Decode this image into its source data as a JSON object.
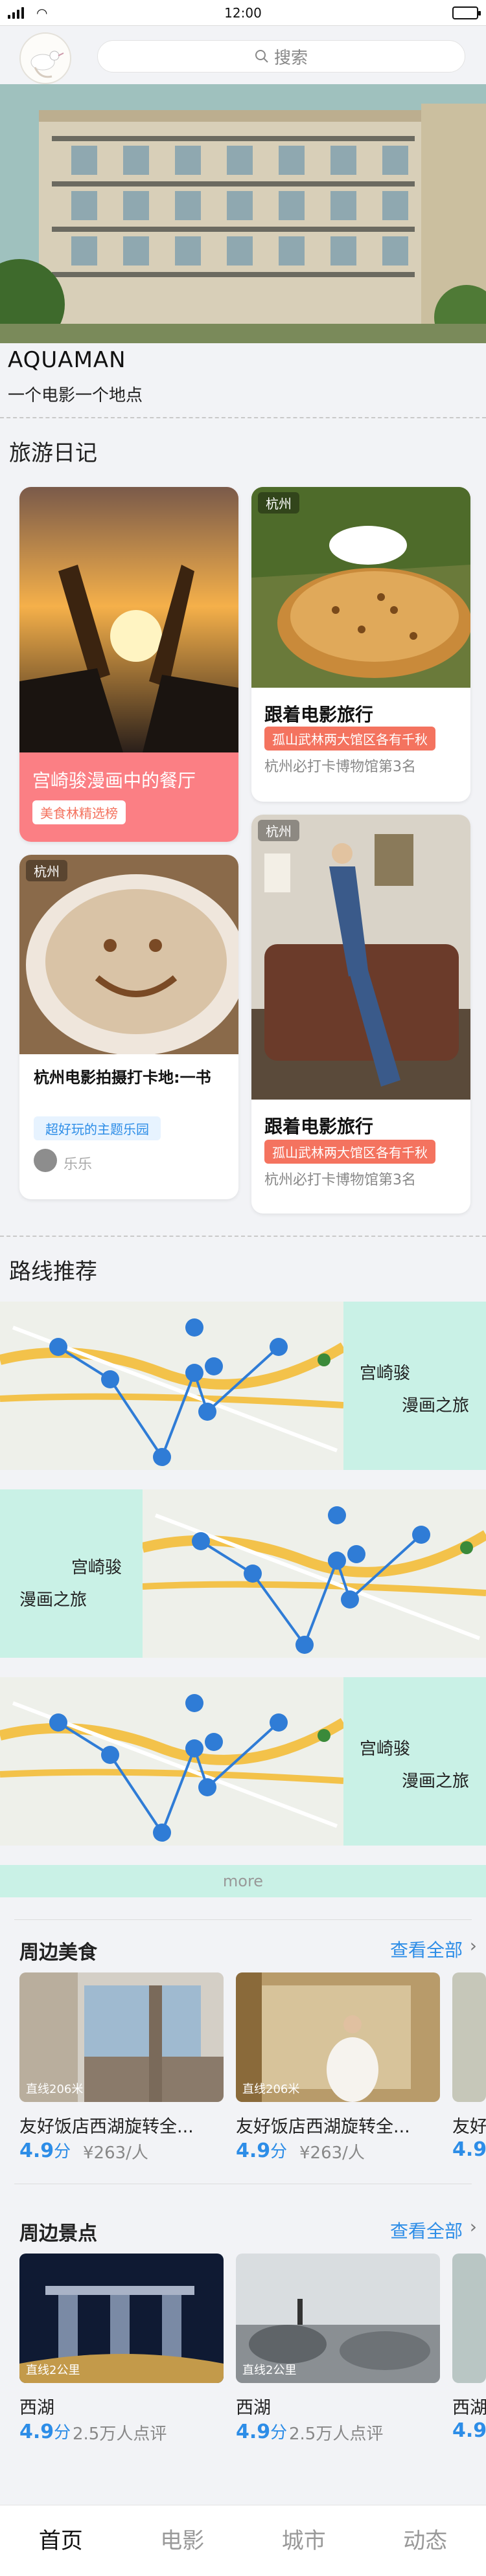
{
  "status": {
    "time": "12:00"
  },
  "header": {
    "search_placeholder": "搜索"
  },
  "brand": {
    "name": "AQUAMAN",
    "tagline": "一个电影一个地点"
  },
  "diary": {
    "title": "旅游日记",
    "cards": [
      {
        "title": "宫崎骏漫画中的餐厅",
        "tag": "美食林精选榜"
      },
      {
        "location": "杭州",
        "title": "跟着电影旅行",
        "tag": "孤山武林两大馆区各有千秋",
        "desc": "杭州必打卡博物馆第3名"
      },
      {
        "location": "杭州",
        "title": "杭州电影拍摄打卡地:一书",
        "tag": "超好玩的主题乐园",
        "author": "乐乐"
      },
      {
        "location": "杭州",
        "title": "跟着电影旅行",
        "tag": "孤山武林两大馆区各有千秋",
        "desc": "杭州必打卡博物馆第3名"
      }
    ]
  },
  "routes": {
    "title": "路线推荐",
    "items": [
      {
        "line1": "宫崎骏",
        "line2": "漫画之旅"
      },
      {
        "line1": "宫崎骏",
        "line2": "漫画之旅"
      },
      {
        "line1": "宫崎骏",
        "line2": "漫画之旅"
      }
    ],
    "more": "more"
  },
  "food": {
    "title": "周边美食",
    "see_all": "查看全部",
    "items": [
      {
        "distance": "直线206米",
        "name": "友好饭店西湖旋转全...",
        "score": "4.9",
        "score_unit": "分",
        "price": "¥263/人"
      },
      {
        "distance": "直线206米",
        "name": "友好饭店西湖旋转全...",
        "score": "4.9",
        "score_unit": "分",
        "price": "¥263/人"
      },
      {
        "name": "友好",
        "score": "4.9"
      }
    ]
  },
  "sights": {
    "title": "周边景点",
    "see_all": "查看全部",
    "items": [
      {
        "distance": "直线2公里",
        "name": "西湖",
        "score": "4.9",
        "score_unit": "分",
        "reviews": "2.5万人点评"
      },
      {
        "distance": "直线2公里",
        "name": "西湖",
        "score": "4.9",
        "score_unit": "分",
        "reviews": "2.5万人点评"
      },
      {
        "name": "西湖",
        "score": "4.9"
      }
    ]
  },
  "tabs": [
    {
      "label": "首页",
      "active": true
    },
    {
      "label": "电影",
      "active": false
    },
    {
      "label": "城市",
      "active": false
    },
    {
      "label": "动态",
      "active": false
    }
  ],
  "colors": {
    "accent": "#2d8de7",
    "route_bg": "#c9f1e6",
    "tag_red": "#f4735f",
    "card_pink": "#fb7f84"
  }
}
